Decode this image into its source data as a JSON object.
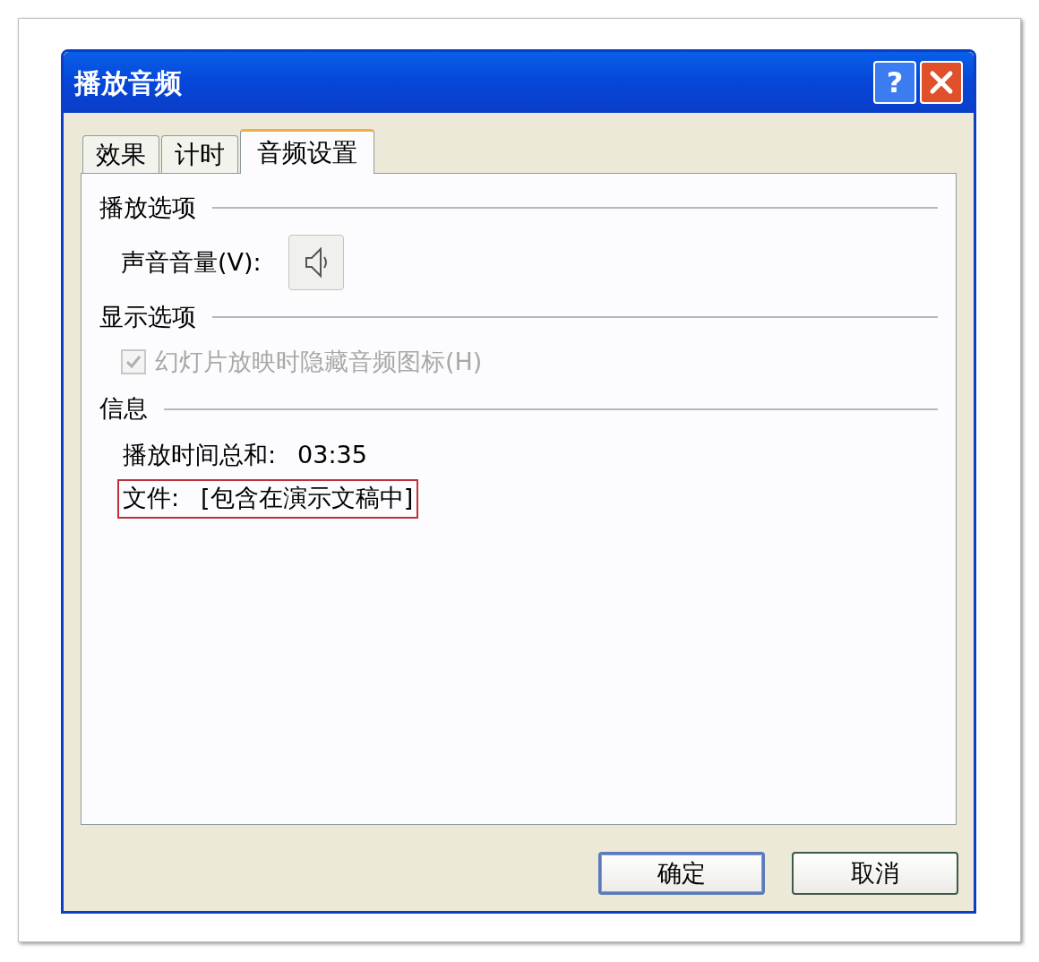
{
  "window": {
    "title": "播放音频",
    "help": "?"
  },
  "tabs": [
    {
      "label": "效果",
      "selected": false
    },
    {
      "label": "计时",
      "selected": false
    },
    {
      "label": "音频设置",
      "selected": true
    }
  ],
  "sections": [
    {
      "title": "播放选项",
      "rows": [
        {
          "kind": "volume",
          "label": "声音音量(V):"
        }
      ]
    },
    {
      "title": "显示选项",
      "rows": [
        {
          "kind": "checkbox",
          "label": "幻灯片放映时隐藏音频图标(H)",
          "checked": true,
          "disabled": true
        }
      ]
    },
    {
      "title": "信息",
      "rows": [
        {
          "kind": "info",
          "label": "播放时间总和:",
          "value": "03:35",
          "highlighted": false
        },
        {
          "kind": "info",
          "label": "文件:",
          "value": "[包含在演示文稿中]",
          "highlighted": true
        }
      ]
    }
  ],
  "buttons": [
    {
      "label": "确定",
      "default": true
    },
    {
      "label": "取消",
      "default": false
    }
  ]
}
